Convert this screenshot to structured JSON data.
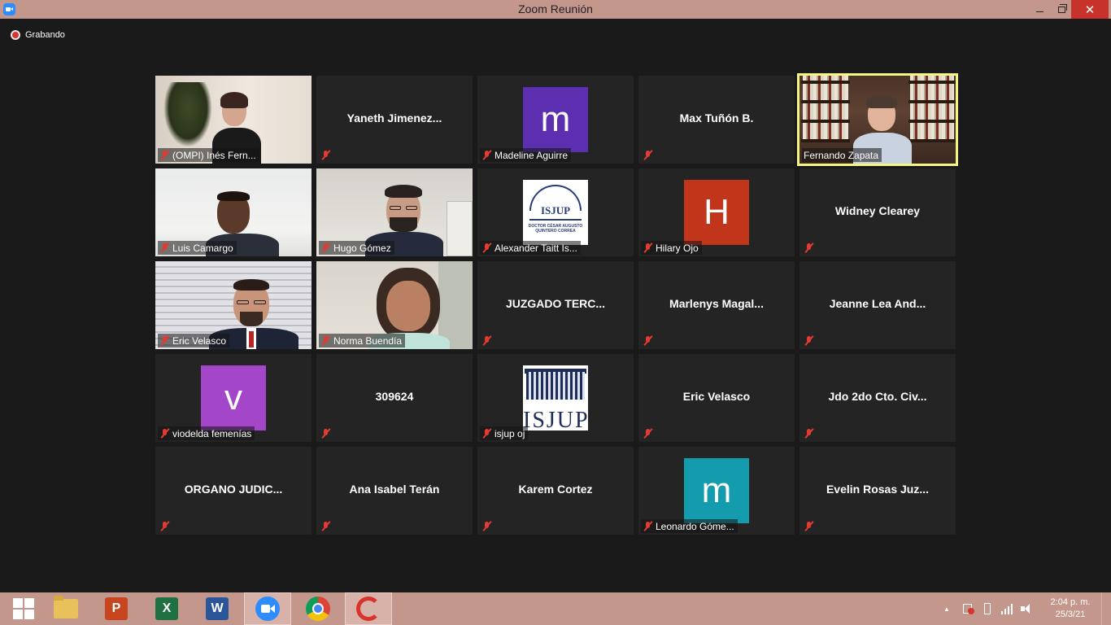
{
  "window": {
    "title": "Zoom Reunión",
    "close_glyph": "✕"
  },
  "recording": {
    "label": "Grabando"
  },
  "participants": [
    {
      "name": "(OMPI) Inés Fern...",
      "display": "video"
    },
    {
      "name": "",
      "center_name": "Yaneth  Jimenez...",
      "display": "name"
    },
    {
      "name": "Madeline Aguirre",
      "display": "avatar",
      "avatar_letter": "m",
      "avatar_color": "#5b2fb0"
    },
    {
      "name": "",
      "center_name": "Max Tuñón B.",
      "display": "name"
    },
    {
      "name": "Fernando Zapata",
      "display": "video",
      "active_speaker": true
    },
    {
      "name": "Luis Camargo",
      "display": "video"
    },
    {
      "name": "Hugo Gómez",
      "display": "video"
    },
    {
      "name": "Alexander Taitt Is...",
      "display": "logo",
      "logo_text": "ISJUP",
      "logo_subtext": "DOCTOR CÉSAR AUGUSTO QUINTERO CORREA"
    },
    {
      "name": "Hilary Ojo",
      "display": "avatar",
      "avatar_letter": "H",
      "avatar_color": "#c1361a"
    },
    {
      "name": "",
      "center_name": "Widney Clearey",
      "display": "name"
    },
    {
      "name": "Eric Velasco",
      "display": "video"
    },
    {
      "name": "Norma Buendía",
      "display": "video"
    },
    {
      "name": "",
      "center_name": "JUZGADO TERC...",
      "display": "name"
    },
    {
      "name": "",
      "center_name": "Marlenys  Magal...",
      "display": "name"
    },
    {
      "name": "",
      "center_name": "Jeanne Lea And...",
      "display": "name"
    },
    {
      "name": "viodelda femenías",
      "display": "avatar",
      "avatar_letter": "v",
      "avatar_color": "#a347c8"
    },
    {
      "name": "",
      "center_name": "309624",
      "display": "name"
    },
    {
      "name": "isjup oj",
      "display": "logo",
      "logo_text": "ISJUP"
    },
    {
      "name": "",
      "center_name": "Eric Velasco",
      "display": "name"
    },
    {
      "name": "",
      "center_name": "Jdo 2do Cto. Civ...",
      "display": "name"
    },
    {
      "name": "",
      "center_name": "ORGANO  JUDIC...",
      "display": "name"
    },
    {
      "name": "",
      "center_name": "Ana Isabel Terán",
      "display": "name"
    },
    {
      "name": "",
      "center_name": "Karem Cortez",
      "display": "name"
    },
    {
      "name": "Leonardo Góme...",
      "display": "avatar",
      "avatar_letter": "m",
      "avatar_color": "#149cae"
    },
    {
      "name": "",
      "center_name": "Evelin Rosas Juz...",
      "display": "name"
    }
  ],
  "taskbar": {
    "apps": [
      {
        "id": "start",
        "icon": "windows-icon"
      },
      {
        "id": "explorer",
        "icon": "folder-icon"
      },
      {
        "id": "powerpoint",
        "icon": "powerpoint-icon",
        "letter": "P",
        "color": "#c8461f"
      },
      {
        "id": "excel",
        "icon": "excel-icon",
        "letter": "X",
        "color": "#1f7144"
      },
      {
        "id": "word",
        "icon": "word-icon",
        "letter": "W",
        "color": "#2a5699"
      },
      {
        "id": "zoom",
        "icon": "zoom-icon",
        "active": true
      },
      {
        "id": "chrome",
        "icon": "chrome-icon"
      },
      {
        "id": "ccleaner",
        "icon": "ccleaner-icon"
      }
    ],
    "tray_chevron": "▲",
    "clock": {
      "time": "2:04 p. m.",
      "date": "25/3/21"
    }
  }
}
